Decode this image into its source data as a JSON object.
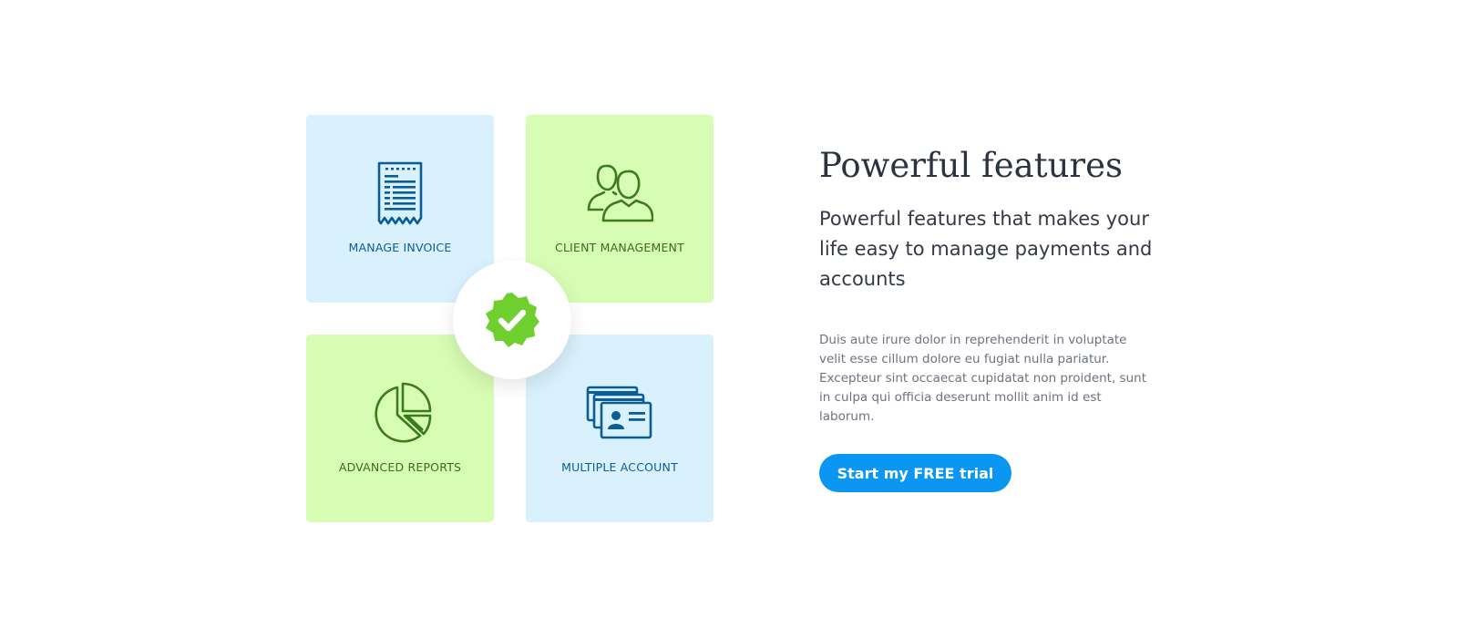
{
  "features": {
    "invoice": {
      "label": "MANAGE INVOICE",
      "icon": "invoice-receipt-icon"
    },
    "client": {
      "label": "CLIENT MANAGEMENT",
      "icon": "users-icon"
    },
    "reports": {
      "label": "ADVANCED REPORTS",
      "icon": "pie-chart-icon"
    },
    "accounts": {
      "label": "MULTIPLE ACCOUNT",
      "icon": "id-cards-icon"
    },
    "center_badge": {
      "icon": "verified-check-badge-icon",
      "color": "#6fcf2e"
    }
  },
  "content": {
    "title": "Powerful features",
    "subtitle": "Powerful features that makes your life easy to manage payments and accounts",
    "body": "Duis aute irure dolor in reprehenderit in voluptate velit esse cillum dolore eu fugiat nulla pariatur. Excepteur sint occaecat cupidatat non proident, sunt in culpa qui officia deserunt mollit anim id est laborum.",
    "cta_label": "Start my FREE trial"
  },
  "colors": {
    "tile_blue": "#d9f1fc",
    "tile_green": "#d7fcb3",
    "icon_blue": "#0c5c96",
    "icon_green": "#3c7a1d",
    "cta_background": "#0b96f2"
  }
}
